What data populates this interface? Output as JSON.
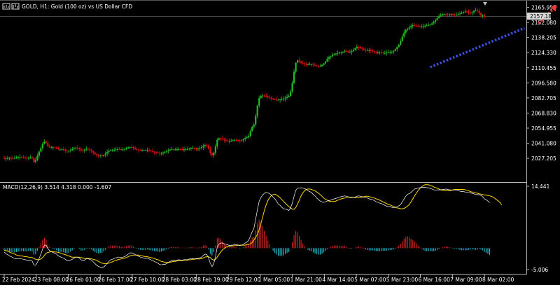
{
  "window": {
    "title": "GOLD, H1:  Gold (100 oz) vs US Dollar CFD"
  },
  "colors": {
    "background": "#000000",
    "bull_candle": "#22bb22",
    "bear_candle": "#dd1111",
    "grid": "#2a2a2a",
    "axis": "#bbbbbb",
    "trendline": "#3b4fe0",
    "arrow": "#ff3333",
    "macd_signal": "#ffd700",
    "macd_line": "#ffffff",
    "hist_pos": "#cc2222",
    "hist_neg": "#22b5c5",
    "price_tag_bg": "#d8d8d8"
  },
  "chart_data": [
    {
      "type": "candlestick",
      "title": "GOLD, H1:  Gold (100 oz) vs US Dollar CFD",
      "y_ticks": [
        "2165.955",
        "2152.080",
        "2138.205",
        "2124.330",
        "2110.455",
        "2096.580",
        "2082.705",
        "2068.830",
        "2054.955",
        "2041.080",
        "2027.205"
      ],
      "ylim": [
        2019.2,
        2167.6
      ],
      "current_price": "2157.183",
      "x_ticks": [
        "22 Feb 2024",
        "23 Feb 08:00",
        "26 Feb 01:00",
        "26 Feb 17:00",
        "27 Feb 10:00",
        "28 Feb 03:00",
        "28 Feb 19:00",
        "29 Feb 12:00",
        "1 Mar 05:00",
        "1 Mar 21:00",
        "4 Mar 14:00",
        "5 Mar 07:00",
        "5 Mar 23:00",
        "6 Mar 16:00",
        "7 Mar 09:00",
        "8 Mar 02:00"
      ],
      "closes": [
        2027,
        2027.3,
        2027.6,
        2027.6,
        2027.4,
        2027.2,
        2027.5,
        2027.9,
        2028.4,
        2028.6,
        2028.4,
        2028.1,
        2027.6,
        2027.1,
        2027.5,
        2028.2,
        2027.2,
        2024,
        2025.5,
        2029.5,
        2033.3,
        2036.5,
        2040.5,
        2042.6,
        2041.3,
        2038.5,
        2037.3,
        2037.3,
        2037.3,
        2037.1,
        2036.2,
        2035.3,
        2035.3,
        2035.5,
        2035.1,
        2034.2,
        2033.7,
        2034.1,
        2034.9,
        2035.8,
        2036.5,
        2037,
        2036.8,
        2035.7,
        2034.4,
        2034.2,
        2035.1,
        2035.9,
        2035.4,
        2034.7,
        2033.9,
        2032.5,
        2031.1,
        2030.3,
        2029.8,
        2029.8,
        2029.4,
        2030.3,
        2031.5,
        2033.1,
        2034.1,
        2034.7,
        2034.9,
        2035.1,
        2035.4,
        2035.8,
        2035.6,
        2035.2,
        2035.3,
        2035.8,
        2036.6,
        2037.2,
        2037.5,
        2037.4,
        2036.8,
        2035.8,
        2035.4,
        2034.7,
        2034.4,
        2034.6,
        2034.7,
        2034.7,
        2034.7,
        2034.3,
        2033.8,
        2033.3,
        2032.9,
        2032.7,
        2032.1,
        2031.8,
        2032.1,
        2032.6,
        2033.1,
        2033.6,
        2034.4,
        2035.2,
        2035.7,
        2035.5,
        2035.5,
        2035.5,
        2035.6,
        2035.5,
        2035.3,
        2035.4,
        2035.5,
        2035.7,
        2036.2,
        2036.3,
        2036.3,
        2036.2,
        2036.1,
        2036.2,
        2036.6,
        2037.4,
        2038.6,
        2039.4,
        2038.9,
        2035.9,
        2032.1,
        2030.1,
        2032.4,
        2038.1,
        2044.2,
        2045.6,
        2045.3,
        2044.8,
        2044.1,
        2043.4,
        2043.1,
        2043.1,
        2043.3,
        2043.8,
        2044.2,
        2043.9,
        2043.5,
        2043.3,
        2043.7,
        2044.7,
        2045.9,
        2046.5,
        2047.9,
        2052.2,
        2056.1,
        2058.2,
        2066.1,
        2075.8,
        2082.6,
        2084.6,
        2084.9,
        2084.6,
        2084.5,
        2083.6,
        2082.6,
        2082.1,
        2081.8,
        2081.4,
        2080.9,
        2080.9,
        2081.5,
        2081.8,
        2081.8,
        2082.8,
        2083.8,
        2084.6,
        2088.6,
        2096.5,
        2106.8,
        2115.1,
        2117.2,
        2116.1,
        2114.8,
        2114.3,
        2113.8,
        2113.4,
        2113.5,
        2113.9,
        2113.9,
        2113.2,
        2112.5,
        2112,
        2111.6,
        2112,
        2113,
        2114.4,
        2116.2,
        2118.6,
        2120.2,
        2121.1,
        2122.4,
        2123.3,
        2123.5,
        2124.1,
        2124.5,
        2124.6,
        2125.2,
        2126.1,
        2125.8,
        2124.8,
        2124.8,
        2125.8,
        2127,
        2128.5,
        2129.7,
        2129.5,
        2128.5,
        2127.6,
        2127,
        2126.4,
        2126.6,
        2126.6,
        2126.4,
        2125.6,
        2124.8,
        2124.5,
        2124.5,
        2124.7,
        2124.4,
        2124,
        2124.1,
        2124.4,
        2124.6,
        2124.8,
        2125.2,
        2126,
        2127.6,
        2129.4,
        2131.7,
        2135.1,
        2139.1,
        2142.7,
        2145.3,
        2146.4,
        2147.5,
        2148.9,
        2149.5,
        2149.1,
        2148.7,
        2148.4,
        2148.2,
        2148.4,
        2148.8,
        2149.2,
        2149.4,
        2149.7,
        2150.2,
        2151.3,
        2152.7,
        2154.2,
        2156.1,
        2157.7,
        2158.9,
        2159.7,
        2159.8,
        2159.5,
        2159.3,
        2159.5,
        2159.7,
        2159.5,
        2159.2,
        2159.2,
        2159.7,
        2160.3,
        2161,
        2161.7,
        2162.2,
        2162.1,
        2161.3,
        2160.8,
        2161.5,
        2162.9,
        2163.5,
        2162.6,
        2160.6,
        2158.6,
        2158.6,
        2157.2
      ],
      "trendline": {
        "from": {
          "index": 244,
          "value": 2111
        },
        "to": {
          "index": 298,
          "value": 2147
        }
      },
      "arrow": {
        "from": {
          "index": 306,
          "value": 2151
        },
        "to": {
          "index": 316,
          "value": 2167
        }
      },
      "grid": false
    },
    {
      "type": "macd",
      "label": "MACD(12,26,9) 3.514 4.318 0.000 -1.607",
      "y_ticks": [
        "14.441",
        "-5.006"
      ],
      "ylim": [
        -5.006,
        14.441
      ],
      "histogram": [
        -0.4,
        -0.7,
        -0.8,
        -0.9,
        -0.9,
        -1,
        -1,
        -0.9,
        -0.8,
        -0.7,
        -0.7,
        -0.7,
        -0.7,
        -0.8,
        -0.7,
        -0.6,
        -0.8,
        -1.5,
        -1.4,
        -0.6,
        0.3,
        1.1,
        2,
        2.4,
        1.9,
        0.9,
        0.3,
        0,
        -0.2,
        -0.3,
        -0.5,
        -0.8,
        -0.9,
        -0.9,
        -0.9,
        -1.1,
        -1.2,
        -1.1,
        -0.8,
        -0.5,
        -0.2,
        0,
        0,
        -0.2,
        -0.5,
        -0.6,
        -0.4,
        -0.1,
        -0.1,
        -0.2,
        -0.3,
        -0.6,
        -0.9,
        -1.1,
        -1.2,
        -1.1,
        -1.1,
        -0.8,
        -0.4,
        0.1,
        0.4,
        0.6,
        0.6,
        0.6,
        0.6,
        0.6,
        0.5,
        0.3,
        0.3,
        0.3,
        0.5,
        0.6,
        0.7,
        0.6,
        0.4,
        0.1,
        -0.1,
        -0.3,
        -0.4,
        -0.4,
        -0.4,
        -0.4,
        -0.3,
        -0.4,
        -0.5,
        -0.6,
        -0.7,
        -0.7,
        -0.8,
        -0.9,
        -0.8,
        -0.6,
        -0.5,
        -0.3,
        -0.1,
        0.2,
        0.3,
        0.3,
        0.2,
        0.2,
        0.2,
        0.1,
        0.1,
        0.1,
        0.1,
        0.1,
        0.2,
        0.2,
        0.2,
        0.1,
        0.1,
        0.1,
        0.2,
        0.3,
        0.6,
        0.7,
        0.5,
        -0.3,
        -1.3,
        -1.7,
        -0.9,
        0.6,
        2.3,
        2.4,
        2.1,
        1.6,
        1.1,
        0.7,
        0.4,
        0.2,
        0.2,
        0.2,
        0.3,
        0.2,
        0,
        -0.1,
        0,
        0.2,
        0.5,
        0.6,
        0.9,
        1.8,
        2.5,
        2.7,
        4.2,
        5.8,
        6.6,
        6.1,
        5.1,
        4,
        2.9,
        1.8,
        0.9,
        0.1,
        -0.6,
        -1.1,
        -1.5,
        -1.8,
        -1.8,
        -1.8,
        -1.7,
        -1.4,
        -1.1,
        -0.9,
        0,
        1.4,
        3,
        4,
        3.7,
        2.8,
        1.9,
        1.1,
        0.5,
        0,
        -0.4,
        -0.6,
        -0.7,
        -1,
        -1.2,
        -1.4,
        -1.5,
        -1.5,
        -1.3,
        -1,
        -0.6,
        -0.2,
        0.1,
        0.3,
        0.5,
        0.6,
        0.6,
        0.6,
        0.6,
        0.5,
        0.5,
        0.5,
        0.3,
        0.1,
        -0.1,
        -0.1,
        0,
        0.1,
        0.3,
        0.4,
        0.3,
        0.1,
        -0.1,
        -0.3,
        -0.4,
        -0.5,
        -0.5,
        -0.5,
        -0.6,
        -0.7,
        -0.7,
        -0.7,
        -0.6,
        -0.6,
        -0.6,
        -0.6,
        -0.5,
        -0.4,
        -0.4,
        -0.3,
        -0.1,
        0.2,
        0.6,
        1,
        1.6,
        2.2,
        2.6,
        2.8,
        2.5,
        2.2,
        1.9,
        1.6,
        1.1,
        0.6,
        0.2,
        -0.1,
        -0.4,
        -0.6,
        -0.7,
        -0.7,
        -0.7,
        -0.7,
        -0.7,
        -0.6,
        -0.4,
        -0.2,
        0,
        0.2,
        0.3,
        0.4,
        0.3,
        0.2,
        0.1,
        -0.1,
        -0.1,
        -0.2,
        -0.3,
        -0.4,
        -0.5,
        -0.5,
        -0.5,
        -0.5,
        -0.4,
        -0.3,
        -0.3,
        -0.3,
        -0.4,
        -0.3,
        -0.2,
        -0.3,
        -0.5,
        -0.9,
        -1.1,
        -1.3,
        -1.6
      ],
      "signal": [
        -0.5,
        -0.6,
        -0.7,
        -0.9,
        -1.1,
        -1.2,
        -1.4,
        -1.6,
        -1.7,
        -1.8,
        -1.8,
        -1.9,
        -2,
        -2,
        -2.1,
        -2.2,
        -2.2,
        -2.4,
        -2.6,
        -2.7,
        -2.7,
        -2.5,
        -2.2,
        -1.7,
        -1.2,
        -1,
        -0.9,
        -0.8,
        -0.8,
        -0.9,
        -0.9,
        -1,
        -1.1,
        -1.3,
        -1.4,
        -1.5,
        -1.7,
        -1.8,
        -2,
        -2.1,
        -2.1,
        -2.1,
        -2.1,
        -2.1,
        -2.2,
        -2.3,
        -2.4,
        -2.4,
        -2.4,
        -2.4,
        -2.5,
        -2.6,
        -2.7,
        -2.9,
        -3.1,
        -3.3,
        -3.5,
        -3.6,
        -3.6,
        -3.6,
        -3.5,
        -3.3,
        -3.2,
        -3,
        -2.9,
        -2.7,
        -2.6,
        -2.5,
        -2.4,
        -2.3,
        -2.2,
        -2,
        -1.8,
        -1.7,
        -1.6,
        -1.6,
        -1.6,
        -1.6,
        -1.7,
        -1.8,
        -1.9,
        -2,
        -2,
        -2.1,
        -2.2,
        -2.3,
        -2.4,
        -2.6,
        -2.7,
        -2.9,
        -3.1,
        -3.2,
        -3.3,
        -3.3,
        -3.3,
        -3.3,
        -3.2,
        -3.1,
        -3.1,
        -3,
        -2.9,
        -2.9,
        -2.9,
        -2.8,
        -2.8,
        -2.8,
        -2.7,
        -2.7,
        -2.6,
        -2.6,
        -2.5,
        -2.5,
        -2.5,
        -2.4,
        -2.3,
        -2.1,
        -2,
        -2,
        -2.2,
        -2.6,
        -2.8,
        -2.6,
        -2.1,
        -1.5,
        -0.9,
        -0.4,
        -0.1,
        0.2,
        0.4,
        0.4,
        0.5,
        0.5,
        0.6,
        0.6,
        0.7,
        0.7,
        0.7,
        0.7,
        0.7,
        0.8,
        0.9,
        1,
        1.3,
        1.9,
        2.5,
        3.2,
        4.3,
        5.7,
        7.3,
        8.8,
        10.1,
        11.1,
        11.8,
        12.3,
        12.5,
        12.6,
        12.4,
        12.1,
        11.8,
        11.3,
        10.9,
        10.5,
        10.1,
        9.7,
        9.4,
        9.1,
        9.1,
        9.5,
        10.3,
        11.2,
        12.2,
        12.9,
        13.4,
        13.7,
        13.8,
        13.8,
        13.7,
        13.5,
        13.4,
        13.1,
        12.8,
        12.5,
        12.1,
        11.7,
        11.4,
        11.2,
        11,
        10.9,
        10.9,
        10.9,
        11,
        11.2,
        11.3,
        11.5,
        11.6,
        11.7,
        11.8,
        11.9,
        11.9,
        11.9,
        11.9,
        11.8,
        11.8,
        11.8,
        11.8,
        11.9,
        12,
        12.1,
        12.1,
        12,
        11.9,
        11.8,
        11.7,
        11.5,
        11.4,
        11.2,
        11,
        10.8,
        10.6,
        10.4,
        10.2,
        10.1,
        9.9,
        9.7,
        9.6,
        9.4,
        9.3,
        9.2,
        9.2,
        9.3,
        9.5,
        9.8,
        10.2,
        10.8,
        11.5,
        12.2,
        12.8,
        13.4,
        13.9,
        14.3,
        14.6,
        14.8,
        14.8,
        14.8,
        14.6,
        14.5,
        14.3,
        14.1,
        14,
        13.8,
        13.6,
        13.5,
        13.4,
        13.4,
        13.4,
        13.4,
        13.5,
        13.6,
        13.7,
        13.7,
        13.7,
        13.7,
        13.7,
        13.7,
        13.6,
        13.5,
        13.4,
        13.2,
        13.1,
        13,
        12.9,
        12.8,
        12.7,
        12.6,
        12.5,
        12.4,
        12.4,
        12.3,
        12.2,
        12.1,
        11.9,
        11.6,
        11.3,
        11,
        10.6,
        10.1
      ],
      "grid": false
    }
  ]
}
